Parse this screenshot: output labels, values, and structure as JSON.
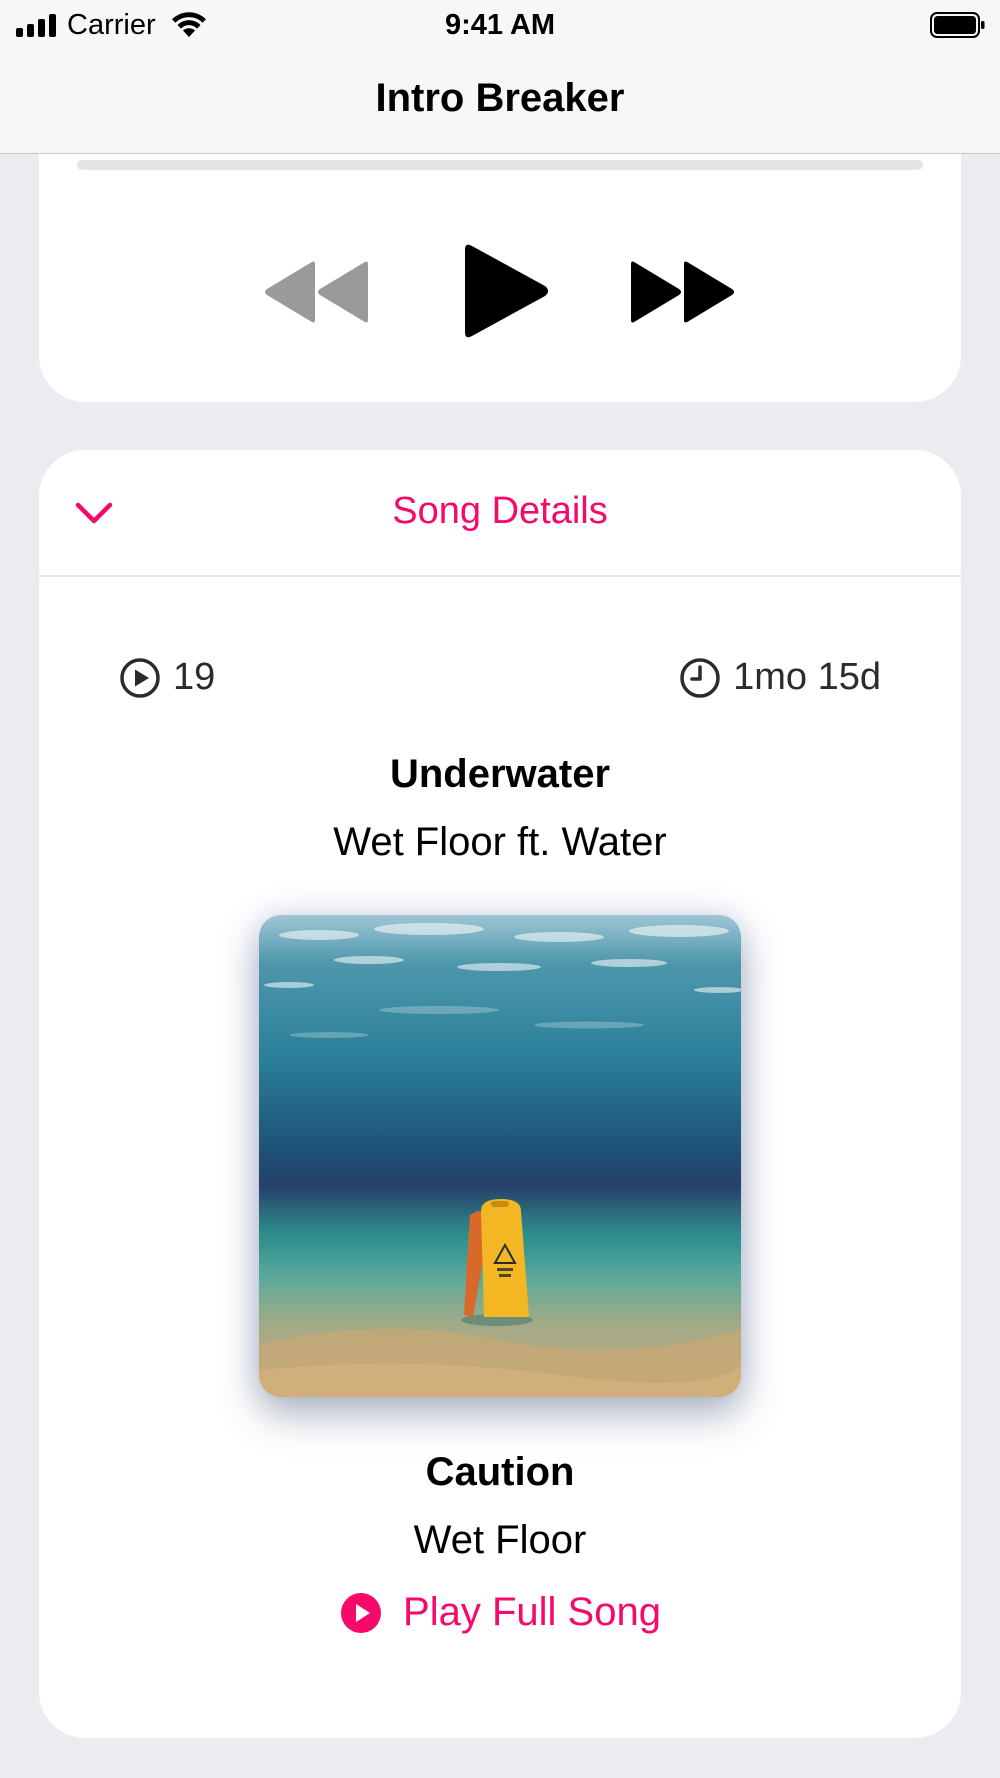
{
  "status_bar": {
    "carrier": "Carrier",
    "time": "9:41 AM"
  },
  "nav": {
    "title": "Intro Breaker"
  },
  "player": {
    "progress": 0.0
  },
  "song_details": {
    "header": "Song Details",
    "play_count": "19",
    "age": "1mo 15d",
    "song_title": "Underwater",
    "song_artist": "Wet Floor ft. Water",
    "album_title": "Caution",
    "album_artist": "Wet Floor",
    "play_full_label": "Play Full Song"
  },
  "colors": {
    "accent": "#f5096b",
    "background": "#ebebf0",
    "card": "#ffffff"
  },
  "icons": {
    "signal": "signal-bars-icon",
    "wifi": "wifi-icon",
    "battery": "battery-icon",
    "rewind": "rewind-icon",
    "play": "play-icon",
    "forward": "fast-forward-icon",
    "collapse": "chevron-down-icon",
    "plays": "play-circle-icon",
    "age": "clock-icon",
    "play_full": "play-circle-filled-icon"
  }
}
